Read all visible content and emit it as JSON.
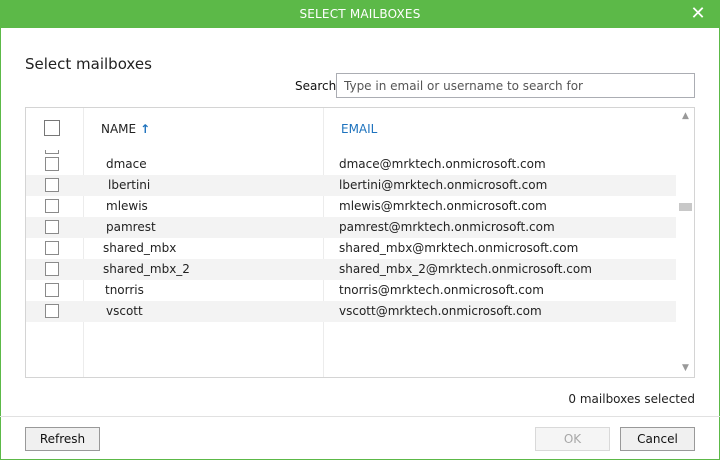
{
  "window": {
    "title": "SELECT MAILBOXES",
    "close_glyph": "✕"
  },
  "heading": "Select mailboxes",
  "search": {
    "label": "Search:",
    "placeholder": "Type in email or username to search for",
    "value": ""
  },
  "table": {
    "columns": {
      "name": "NAME",
      "sort_arrow": "↑",
      "email": "EMAIL"
    },
    "rows": [
      {
        "name": "dmace",
        "email": "dmace@mrktech.onmicrosoft.com"
      },
      {
        "name": "lbertini",
        "email": "lbertini@mrktech.onmicrosoft.com"
      },
      {
        "name": "mlewis",
        "email": "mlewis@mrktech.onmicrosoft.com"
      },
      {
        "name": "pamrest",
        "email": "pamrest@mrktech.onmicrosoft.com"
      },
      {
        "name": "shared_mbx",
        "email": "shared_mbx@mrktech.onmicrosoft.com"
      },
      {
        "name": "shared_mbx_2",
        "email": "shared_mbx_2@mrktech.onmicrosoft.com"
      },
      {
        "name": "tnorris",
        "email": "tnorris@mrktech.onmicrosoft.com"
      },
      {
        "name": "vscott",
        "email": "vscott@mrktech.onmicrosoft.com"
      }
    ]
  },
  "scrollbar": {
    "up_glyph": "▲",
    "down_glyph": "▼"
  },
  "selection_count": "0 mailboxes selected",
  "buttons": {
    "refresh": "Refresh",
    "ok": "OK",
    "cancel": "Cancel"
  },
  "colors": {
    "titlebar": "#5cb948",
    "accent_link": "#1e73be"
  }
}
